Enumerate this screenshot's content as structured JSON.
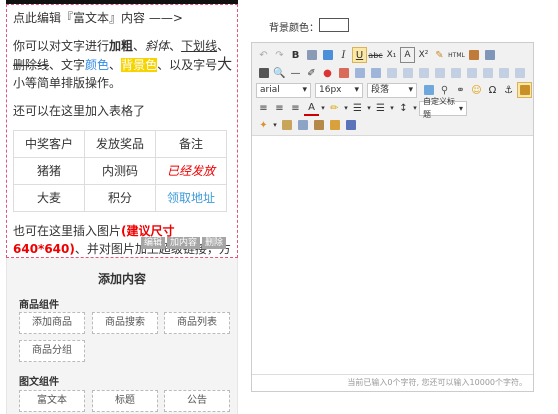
{
  "rich_text": {
    "line1": "点此编辑『富文本』内容 ——>",
    "p2_a": "你可以对文字进行",
    "p2_bold": "加粗",
    "p2_sep1": "、",
    "p2_italic": "斜体",
    "p2_sep2": "、",
    "p2_underline": "下划线",
    "p2_sep3": "、",
    "p2_strike": "删除线",
    "p2_b": "、文字",
    "p2_color": "颜色",
    "p2_sep4": "、",
    "p2_bg": "背景色",
    "p2_c": "、以及字号",
    "p2_big": "大",
    "p2_d": "小等简单排版操作。",
    "p3": "还可以在这里加入表格了",
    "table": {
      "headers": [
        "中奖客户",
        "发放奖品",
        "备注"
      ],
      "rows": [
        [
          "猪猪",
          "内测码",
          "已经发放"
        ],
        [
          "大麦",
          "积分",
          "领取地址"
        ]
      ]
    },
    "p4_a": "也可在这里插入图片",
    "p4_red": "(建议尺寸640*640)",
    "p4_b": "、并对图片加上超级链接，方便用户点击。",
    "actions": [
      "编辑",
      "加内容",
      "删除"
    ]
  },
  "add_panel": {
    "title": "添加内容",
    "group1": "商品组件",
    "g1_items": [
      "添加商品",
      "商品搜索",
      "商品列表",
      "商品分组"
    ],
    "group2": "图文组件",
    "g2_items": [
      "富文本",
      "标题",
      "公告"
    ]
  },
  "editor": {
    "bg_label": "背景颜色：",
    "bg_color": "#ffffff",
    "font_family": "arial",
    "font_size": "16px",
    "paragraph": "段落",
    "custom_title": "自定义标题",
    "html_label": "HTML",
    "counter": "当前已输入0个字符, 您还可以输入10000个字符。"
  }
}
